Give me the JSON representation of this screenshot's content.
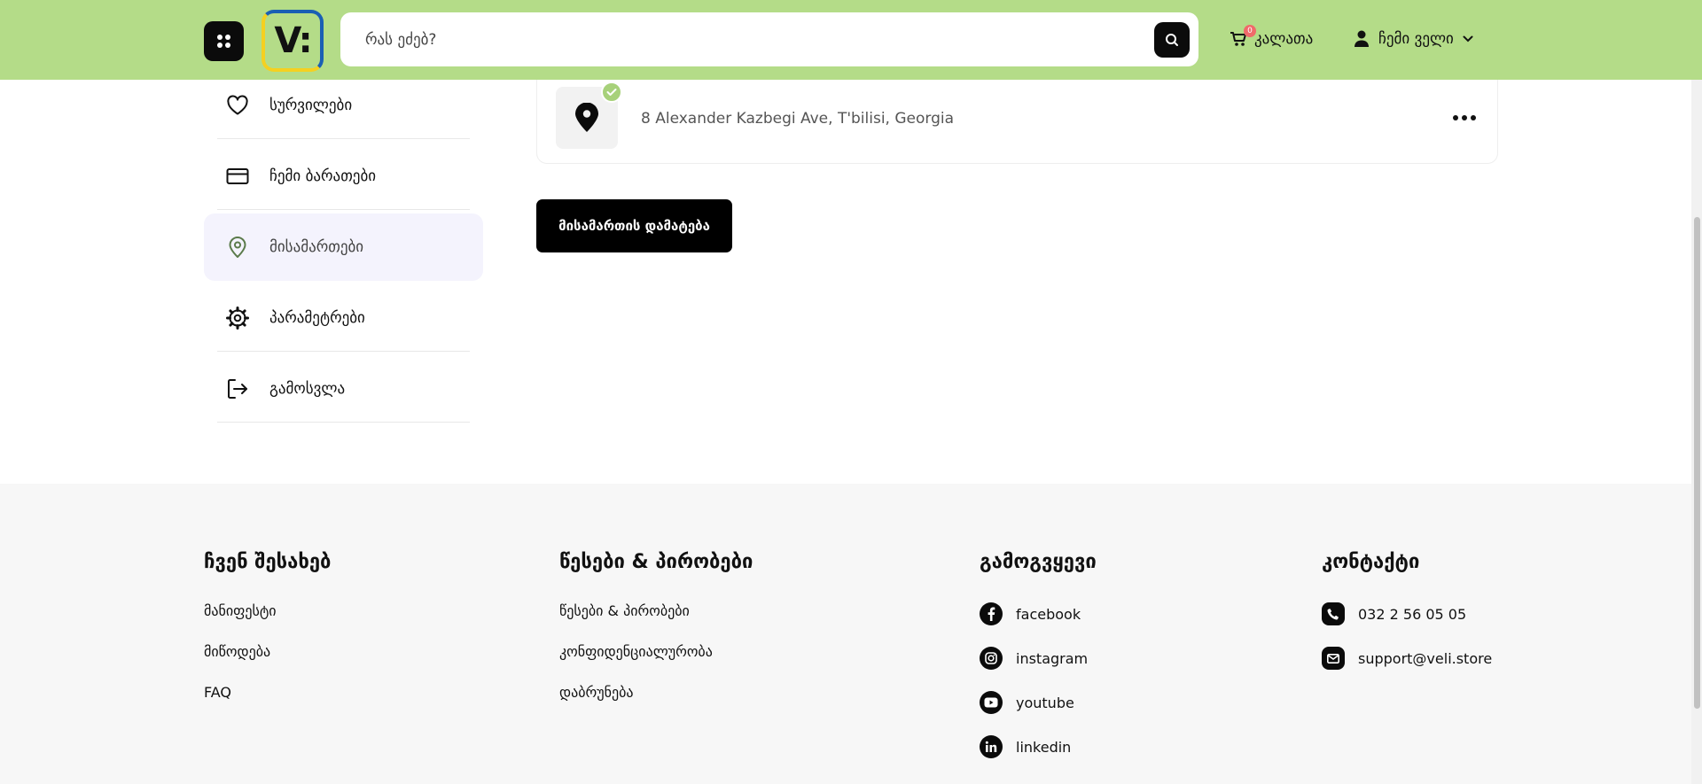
{
  "header": {
    "search_placeholder": "რას ეძებ?",
    "logo_text": "V:",
    "cart_count": "0",
    "cart_label": "კალათა",
    "profile_label": "ჩემი ველი"
  },
  "sidebar": {
    "items": [
      {
        "label": "სურვილები",
        "icon": "heart-icon"
      },
      {
        "label": "ჩემი ბარათები",
        "icon": "credit-card-icon"
      },
      {
        "label": "მისამართები",
        "icon": "location-pin-icon",
        "active": true
      },
      {
        "label": "პარამეტრები",
        "icon": "gear-icon"
      },
      {
        "label": "გამოსვლა",
        "icon": "logout-icon"
      }
    ]
  },
  "address": {
    "text": "8 Alexander Kazbegi Ave, T'bilisi, Georgia",
    "verified": true
  },
  "add_address_label": "მისამართის დამატება",
  "footer": {
    "about": {
      "title": "ჩვენ შესახებ",
      "links": [
        "მანიფესტი",
        "მიწოდება",
        "FAQ"
      ]
    },
    "terms": {
      "title": "წესები & პირობები",
      "links": [
        "წესები & პირობები",
        "კონფიდენციალურობა",
        "დაბრუნება"
      ]
    },
    "follow": {
      "title": "გამოგვყევი",
      "links": [
        "facebook",
        "instagram",
        "youtube",
        "linkedin"
      ]
    },
    "contact": {
      "title": "კონტაქტი",
      "phone": "032 2 56 05 05",
      "email": "support@veli.store"
    }
  },
  "colors": {
    "header_bg": "#b4dc88",
    "active_item_bg": "#f4f3fd",
    "footer_bg": "#f7f7f7",
    "verified_badge": "#a7d17a",
    "cart_badge": "#f06a6a"
  }
}
